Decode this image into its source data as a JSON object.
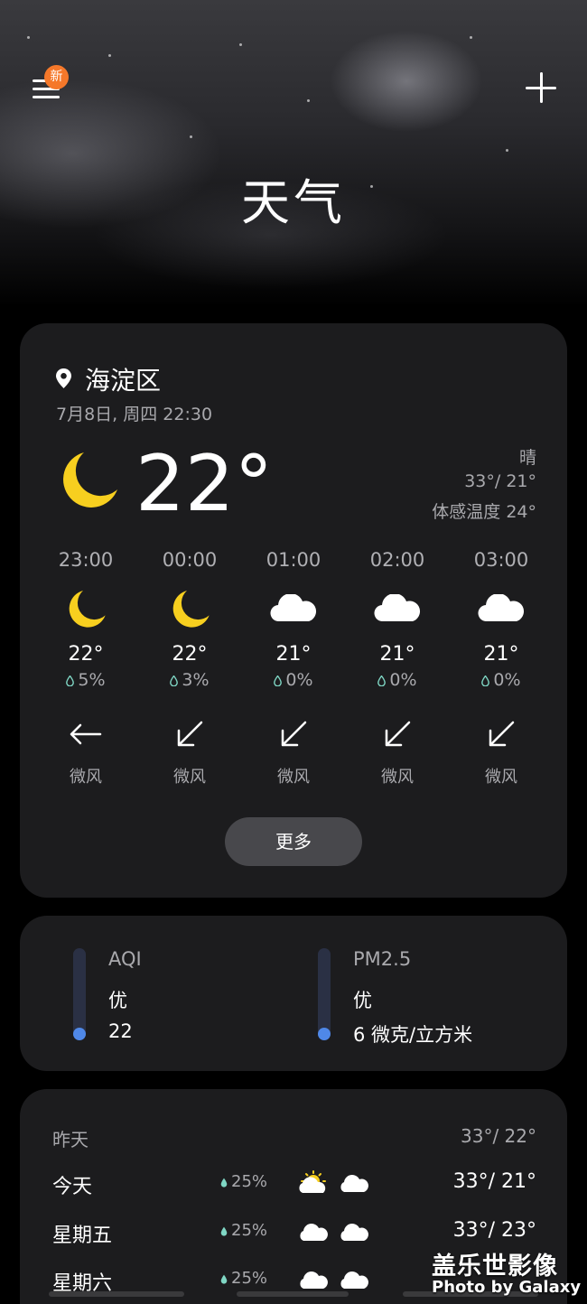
{
  "header": {
    "title": "天气",
    "menu_badge": "新",
    "menu_icon": "menu-icon",
    "add_icon": "plus-icon"
  },
  "current": {
    "location": "海淀区",
    "datetime": "7月8日, 周四 22:30",
    "temperature": "22°",
    "condition": "晴",
    "hi_lo": "33°/ 21°",
    "feels_like": "体感温度 24°",
    "icon": "moon-icon"
  },
  "hourly": [
    {
      "time": "23:00",
      "icon": "moon-icon",
      "temp": "22°",
      "rain": "5%",
      "wind_dir": "west-arrow-icon",
      "wind": "微风"
    },
    {
      "time": "00:00",
      "icon": "moon-icon",
      "temp": "22°",
      "rain": "3%",
      "wind_dir": "southwest-arrow-icon",
      "wind": "微风"
    },
    {
      "time": "01:00",
      "icon": "cloud-icon",
      "temp": "21°",
      "rain": "0%",
      "wind_dir": "southwest-arrow-icon",
      "wind": "微风"
    },
    {
      "time": "02:00",
      "icon": "cloud-icon",
      "temp": "21°",
      "rain": "0%",
      "wind_dir": "southwest-arrow-icon",
      "wind": "微风"
    },
    {
      "time": "03:00",
      "icon": "cloud-icon",
      "temp": "21°",
      "rain": "0%",
      "wind_dir": "southwest-arrow-icon",
      "wind": "微风"
    }
  ],
  "more_label": "更多",
  "air": {
    "aqi": {
      "label": "AQI",
      "level": "优",
      "value": "22"
    },
    "pm25": {
      "label": "PM2.5",
      "level": "优",
      "value": "6 微克/立方米"
    },
    "accent_color": "#4f88e8"
  },
  "forecast": [
    {
      "day": "昨天",
      "rain": "",
      "icons": [],
      "temps": "33°/ 22°"
    },
    {
      "day": "今天",
      "rain": "25%",
      "icons": [
        "partly-sunny-icon",
        "cloud-icon"
      ],
      "temps": "33°/ 21°"
    },
    {
      "day": "星期五",
      "rain": "25%",
      "icons": [
        "cloud-icon",
        "cloud-icon"
      ],
      "temps": "33°/ 23°"
    },
    {
      "day": "星期六",
      "rain": "25%",
      "icons": [
        "cloud-icon",
        "cloud-icon"
      ],
      "temps": ""
    }
  ],
  "watermark": {
    "title": "盖乐世影像",
    "subtitle": "Photo by Galaxy"
  }
}
